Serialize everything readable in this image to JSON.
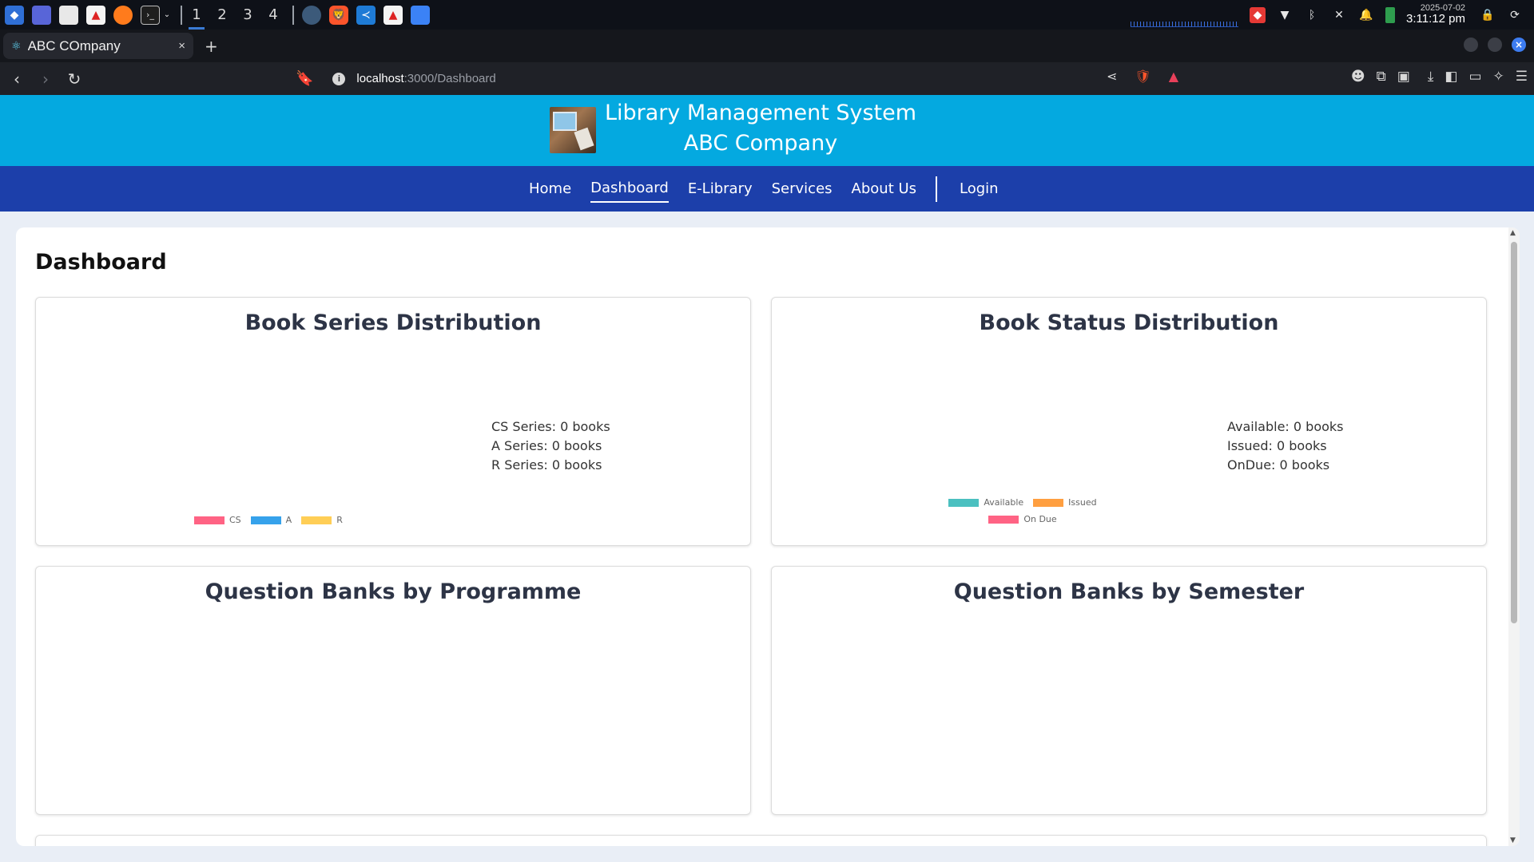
{
  "taskbar": {
    "workspaces": [
      "1",
      "2",
      "3",
      "4"
    ],
    "date": "2025-07-02",
    "time": "3:11:12 pm"
  },
  "browser": {
    "tab_title": "ABC COmpany",
    "new_tab": "+",
    "close_tab": "×",
    "url_host": "localhost",
    "url_path": ":3000/Dashboard"
  },
  "header": {
    "title_line1": "Library Management System",
    "title_line2": "ABC Company"
  },
  "nav": {
    "items": [
      "Home",
      "Dashboard",
      "E-Library",
      "Services",
      "About Us"
    ],
    "login": "Login",
    "active": "Dashboard"
  },
  "page": {
    "title": "Dashboard"
  },
  "panels": {
    "series": {
      "title": "Book Series Distribution",
      "stats": [
        "CS Series: 0 books",
        "A Series: 0 books",
        "R Series: 0 books"
      ],
      "legend": [
        {
          "label": "CS",
          "color": "#ff6384"
        },
        {
          "label": "A",
          "color": "#36a2eb"
        },
        {
          "label": "R",
          "color": "#ffce56"
        }
      ]
    },
    "status": {
      "title": "Book Status Distribution",
      "stats": [
        "Available: 0 books",
        "Issued: 0 books",
        "OnDue: 0 books"
      ],
      "legend": [
        {
          "label": "Available",
          "color": "#4bc0c0"
        },
        {
          "label": "Issued",
          "color": "#ff9f40"
        },
        {
          "label": "On Due",
          "color": "#ff6384"
        }
      ]
    },
    "programme": {
      "title": "Question Banks by Programme"
    },
    "semester": {
      "title": "Question Banks by Semester"
    }
  },
  "chart_data": [
    {
      "type": "pie",
      "title": "Book Series Distribution",
      "categories": [
        "CS",
        "A",
        "R"
      ],
      "values": [
        0,
        0,
        0
      ]
    },
    {
      "type": "pie",
      "title": "Book Status Distribution",
      "categories": [
        "Available",
        "Issued",
        "On Due"
      ],
      "values": [
        0,
        0,
        0
      ]
    },
    {
      "type": "bar",
      "title": "Question Banks by Programme",
      "categories": [],
      "values": []
    },
    {
      "type": "bar",
      "title": "Question Banks by Semester",
      "categories": [],
      "values": []
    }
  ]
}
